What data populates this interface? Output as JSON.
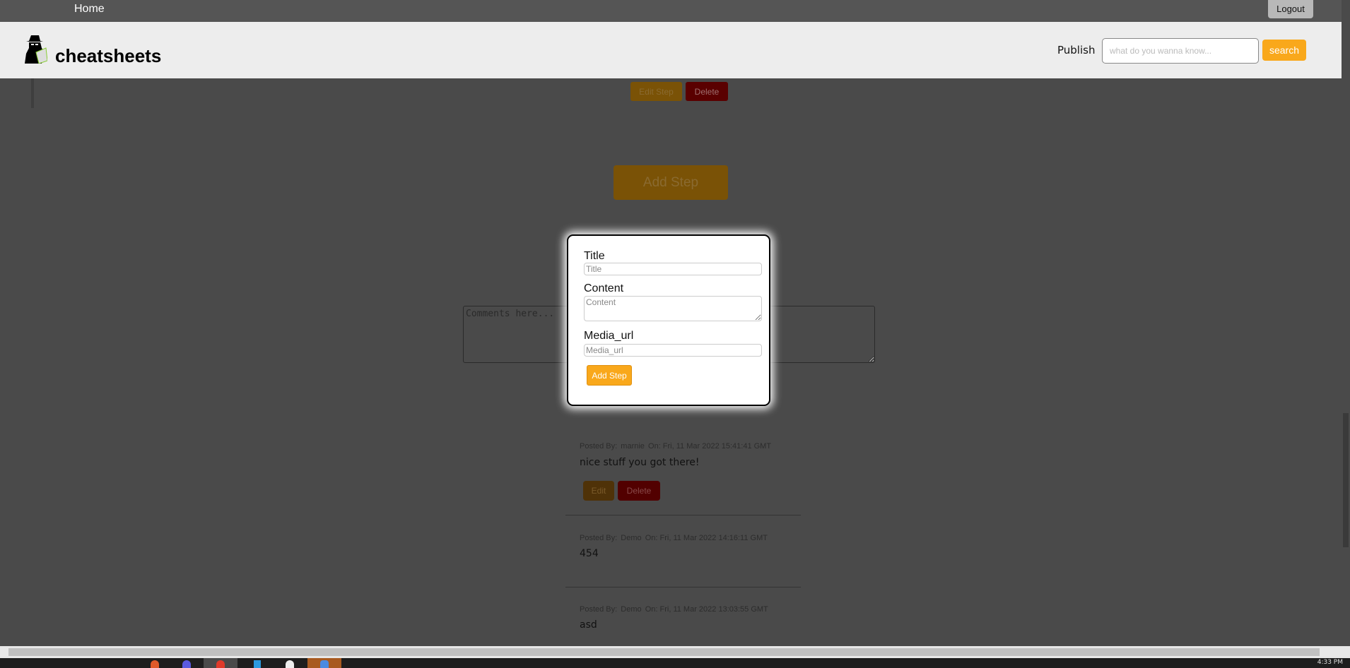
{
  "topbar": {
    "home": "Home",
    "logout": "Logout"
  },
  "header": {
    "brand": "cheatsheets",
    "publish": "Publish",
    "search_placeholder": "what do you wanna know...",
    "search_button": "search"
  },
  "step_actions": {
    "edit": "Edit Step",
    "delete": "Delete"
  },
  "add_step_button": "Add Step",
  "comment_box": {
    "placeholder": "Comments here..."
  },
  "modal": {
    "title_label": "Title",
    "title_placeholder": "Title",
    "content_label": "Content",
    "content_placeholder": "Content",
    "media_label": "Media_url",
    "media_placeholder": "Media_url",
    "submit": "Add Step"
  },
  "comments": [
    {
      "prefix": "Posted By:",
      "author": "marnie",
      "on": "On: Fri, 11 Mar 2022 15:41:41 GMT",
      "text": "nice stuff you got there!",
      "edit": "Edit",
      "delete": "Delete"
    },
    {
      "prefix": "Posted By:",
      "author": "Demo",
      "on": "On: Fri, 11 Mar 2022 14:16:11 GMT",
      "text": "454"
    },
    {
      "prefix": "Posted By:",
      "author": "Demo",
      "on": "On: Fri, 11 Mar 2022 13:03:55 GMT",
      "text": "asd"
    }
  ],
  "taskbar": {
    "clock": "4:33 PM"
  },
  "colors": {
    "accent": "#f9a81b",
    "danger": "#a00000",
    "overlay": "#4a4a4a",
    "header": "#ededed"
  }
}
